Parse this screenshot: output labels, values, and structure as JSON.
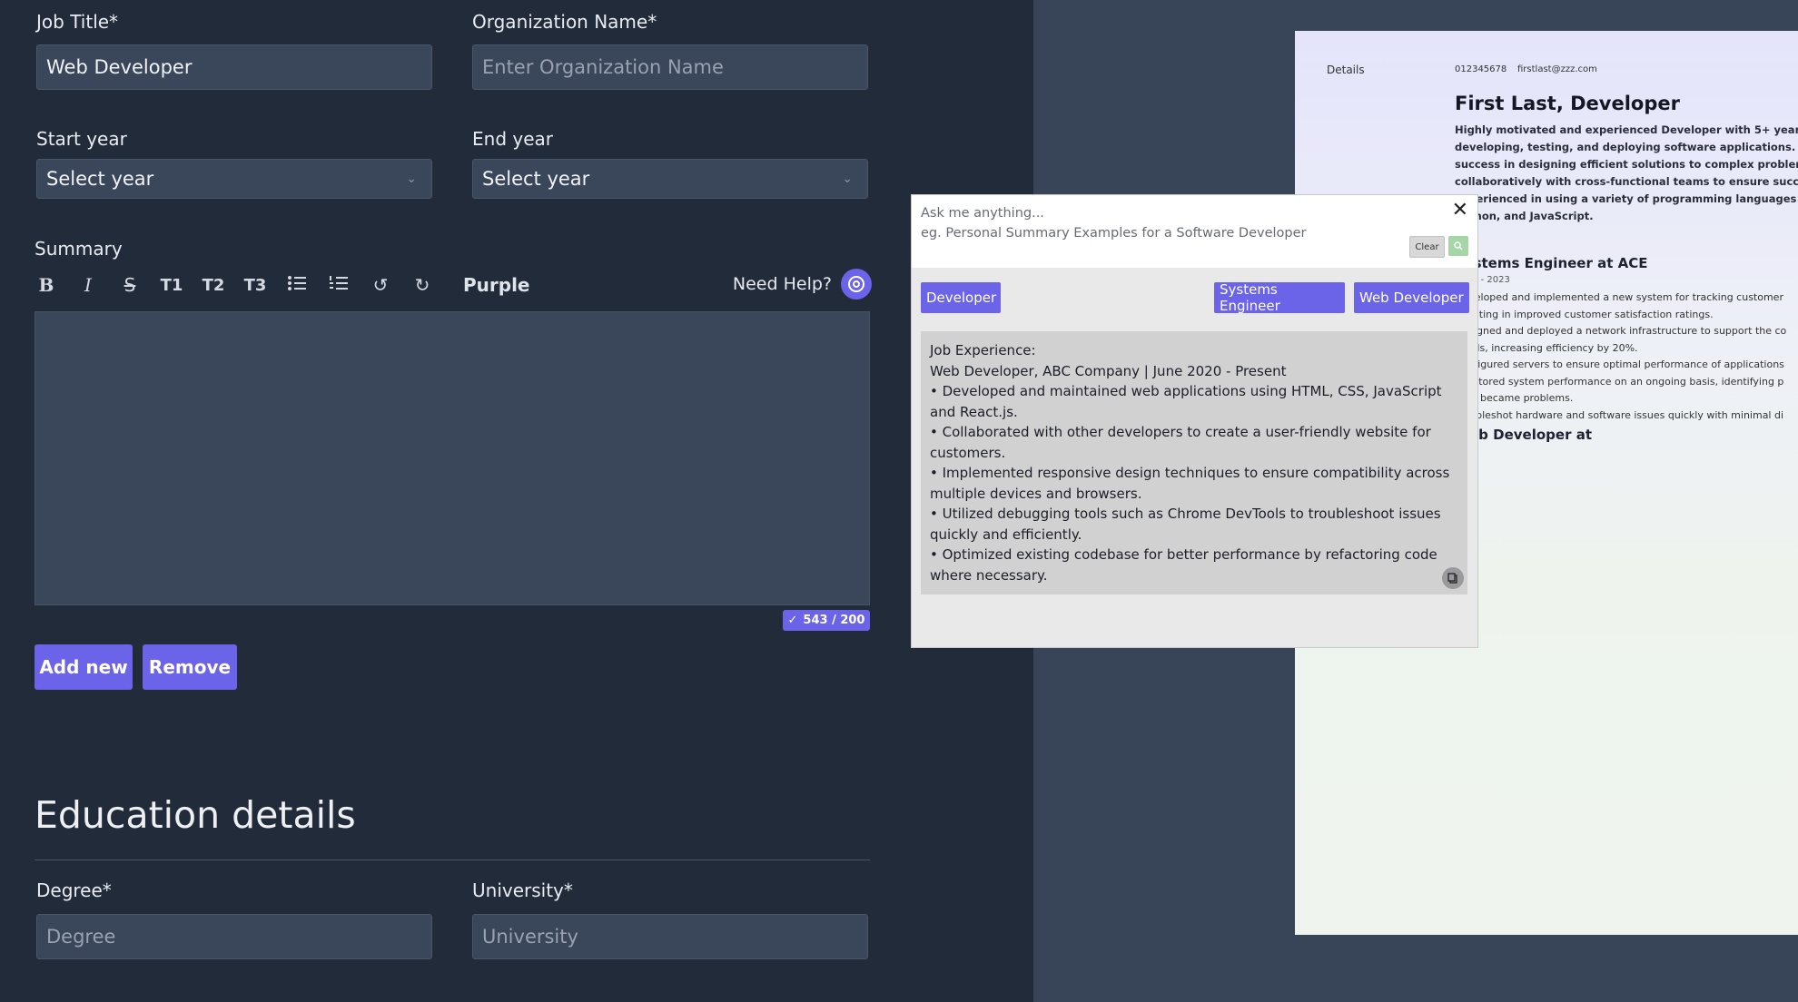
{
  "form": {
    "job_title_label": "Job Title*",
    "job_title_value": "Web Developer",
    "org_label": "Organization Name*",
    "org_placeholder": "Enter Organization Name",
    "start_label": "Start year",
    "start_value": "Select year",
    "end_label": "End year",
    "end_value": "Select year",
    "summary_label": "Summary",
    "toolbar": {
      "bold": "B",
      "italic": "I",
      "strike": "S",
      "t1": "T1",
      "t2": "T2",
      "t3": "T3",
      "purple": "Purple",
      "need_help": "Need Help?"
    },
    "counter": "543 / 200",
    "add_new": "Add new",
    "remove": "Remove"
  },
  "education": {
    "heading": "Education details",
    "degree_label": "Degree*",
    "degree_placeholder": "Degree",
    "university_label": "University*",
    "university_placeholder": "University"
  },
  "assistant": {
    "ask_placeholder": "Ask me anything...",
    "example": "eg. Personal Summary Examples for a Software Developer",
    "clear": "Clear",
    "chips": [
      "Developer",
      "Systems Engineer",
      "Web Developer"
    ],
    "result_lines": [
      "Job Experience:",
      "Web Developer, ABC Company | June 2020 - Present",
      "• Developed and maintained web applications using HTML, CSS, JavaScript and React.js.",
      "• Collaborated with other developers to create a user-friendly website for customers.",
      "• Implemented responsive design techniques to ensure compatibility across multiple devices and browsers.",
      "• Utilized debugging tools such as Chrome DevTools to troubleshoot issues quickly and efficiently.",
      "• Optimized existing codebase for better performance by refactoring code where necessary."
    ]
  },
  "resume": {
    "details": "Details",
    "phone": "012345678",
    "email": "firstlast@zzz.com",
    "name": "First Last, Developer",
    "summary": "Highly motivated and experienced Developer with 5+ years of e developing, testing, and deploying software applications. Prove success in designing efficient solutions to complex problems. S collaboratively with cross-functional teams to ensure successf Experienced in using a variety of programming languages inclu Python, and JavaScript.",
    "job1": "Systems Engineer at ACE",
    "job1_dates": "2021 - 2023",
    "bullets": [
      "Developed and implemented a new system for tracking customer",
      "resulting in improved customer satisfaction ratings.",
      "Designed and deployed a network infrastructure to support the co",
      "needs, increasing efficiency by 20%.",
      "Configured servers to ensure optimal performance of applications",
      "Monitored system performance on an ongoing basis, identifying p",
      "they became problems.",
      "Troubleshot hardware and software issues quickly with minimal di"
    ],
    "job2": "Web Developer at"
  }
}
